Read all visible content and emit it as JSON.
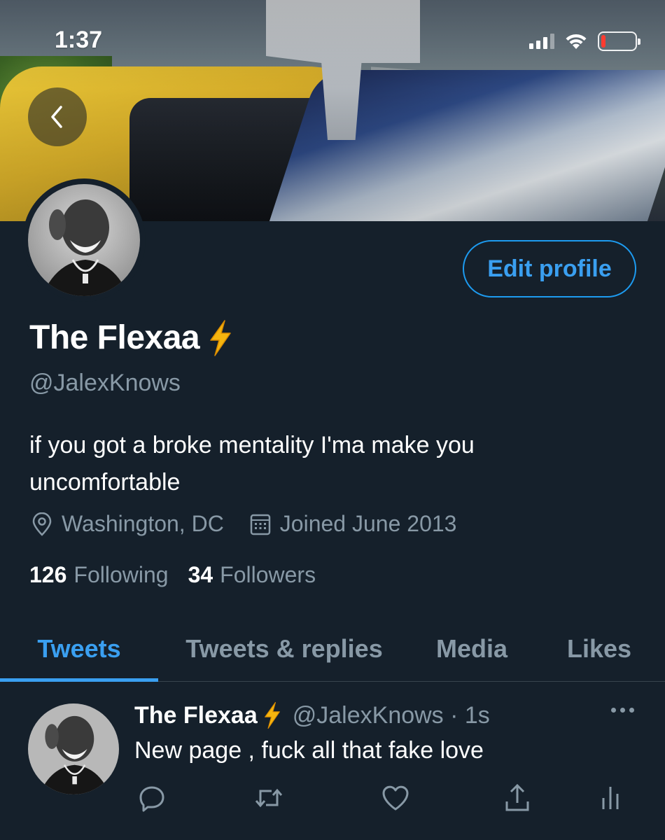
{
  "status_bar": {
    "time": "1:37",
    "battery_level": 0.14
  },
  "profile": {
    "display_name": "The Flexaa",
    "name_emoji": "⚡",
    "handle": "@JalexKnows",
    "bio": "if you got a broke mentality I'ma make you uncomfortable",
    "location": "Washington, DC",
    "joined": "Joined June 2013",
    "following_count": "126",
    "following_label": "Following",
    "followers_count": "34",
    "followers_label": "Followers",
    "edit_button_label": "Edit profile"
  },
  "tabs": [
    {
      "label": "Tweets",
      "active": true
    },
    {
      "label": "Tweets & replies",
      "active": false
    },
    {
      "label": "Media",
      "active": false
    },
    {
      "label": "Likes",
      "active": false
    }
  ],
  "tweet": {
    "author_name": "The Flexaa",
    "author_emoji": "⚡",
    "author_handle_time": "@JalexKnows · 1s",
    "text": "New page , fuck all that fake love",
    "actions": [
      "reply-icon",
      "retweet-icon",
      "like-icon",
      "share-icon",
      "analytics-icon"
    ]
  },
  "colors": {
    "background": "#15202b",
    "accent": "#1d9bf0",
    "secondary_text": "#8899a6",
    "divider": "#38444d"
  }
}
